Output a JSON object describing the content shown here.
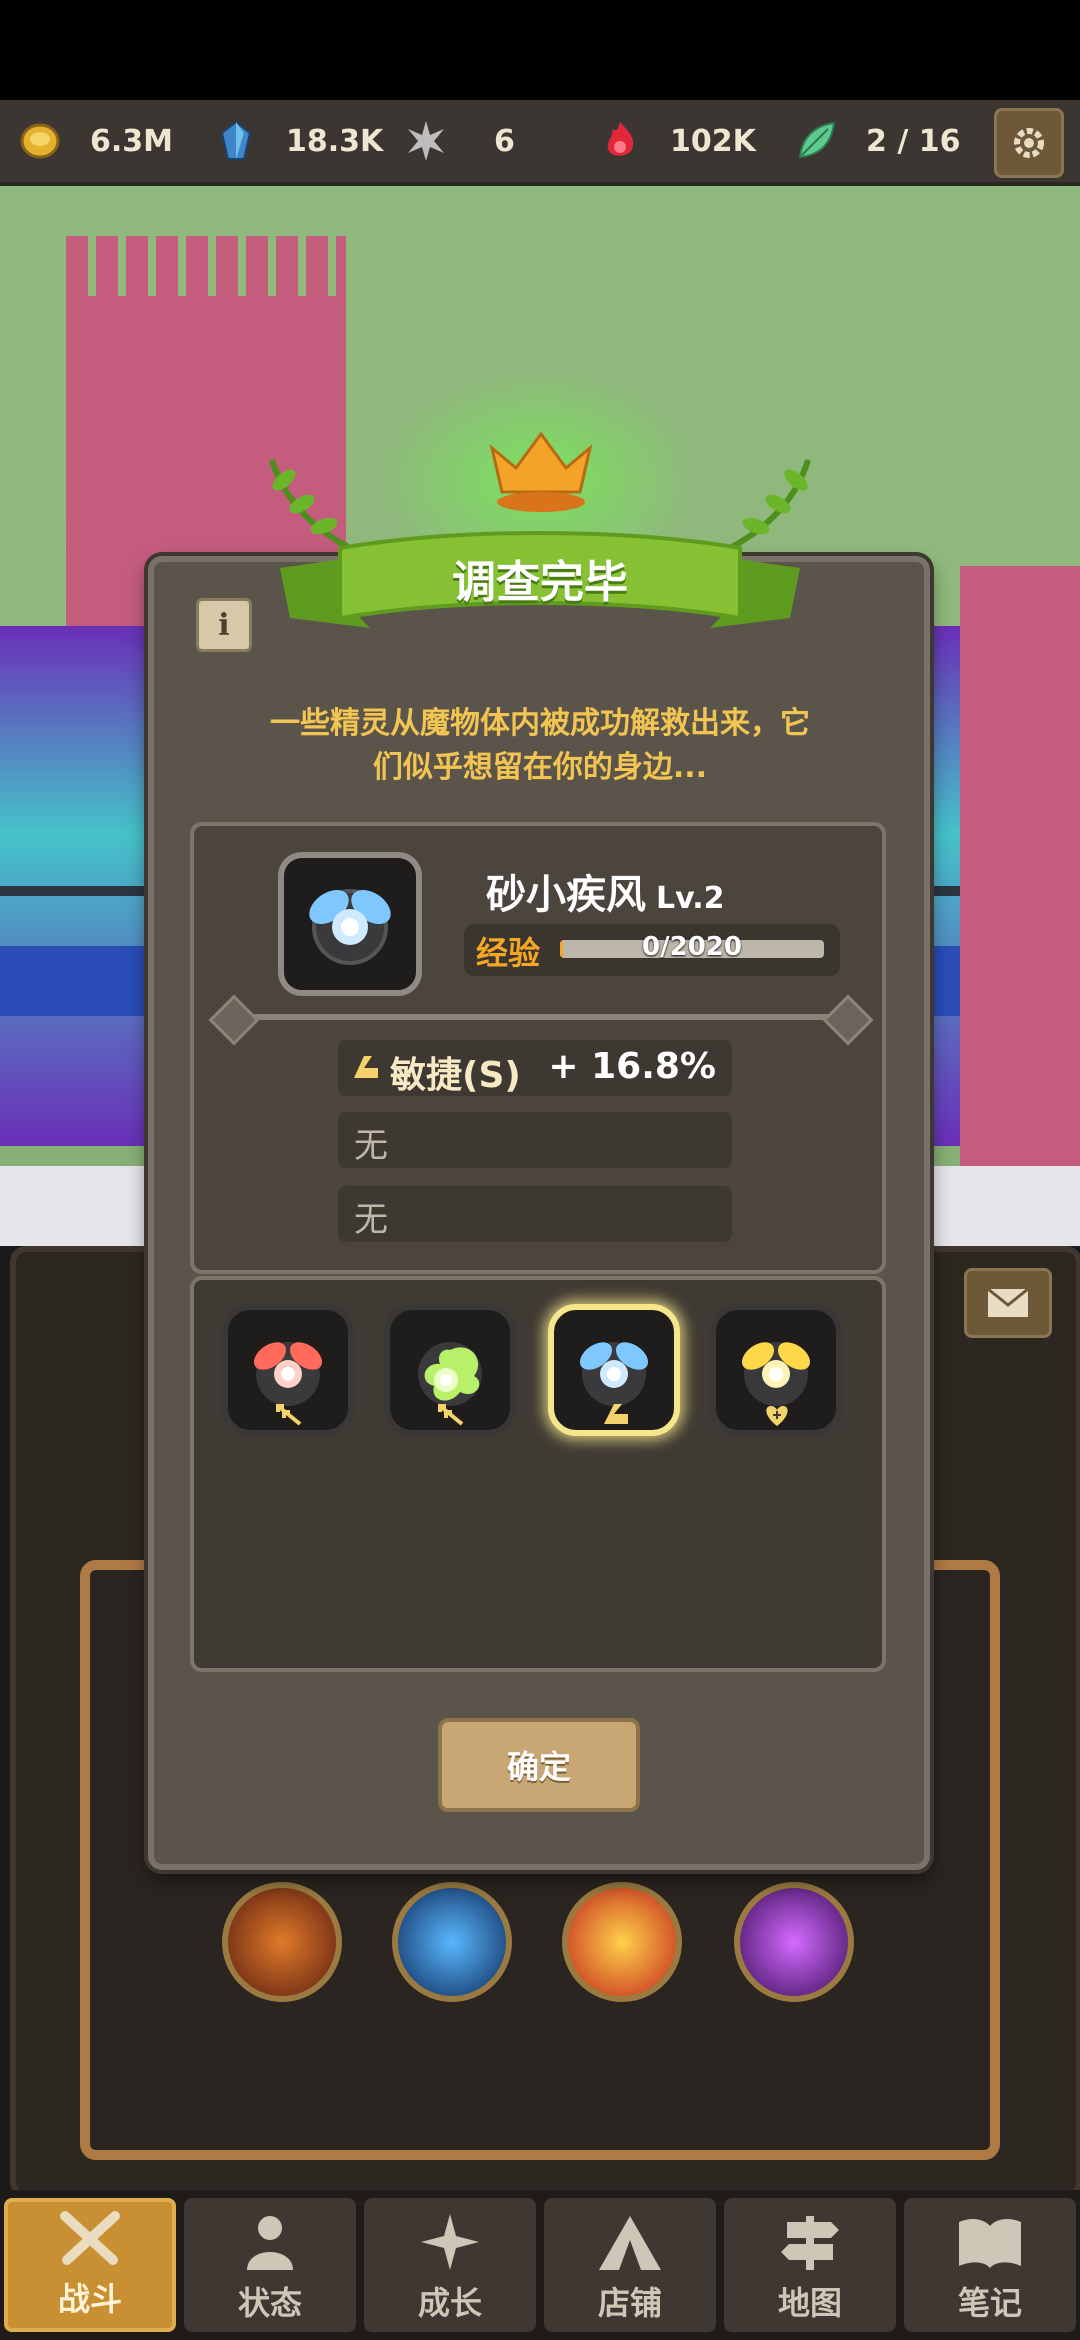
{
  "resources": [
    {
      "icon": "gold-coin-icon",
      "value": "6.3M"
    },
    {
      "icon": "blue-crystal-icon",
      "value": "18.3K"
    },
    {
      "icon": "star-shard-icon",
      "value": "6"
    },
    {
      "icon": "red-flame-gem-icon",
      "value": "102K"
    },
    {
      "icon": "green-leaf-icon",
      "value": "2 / 16"
    }
  ],
  "dialog": {
    "title": "调查完毕",
    "description_line1": "一些精灵从魔物体内被成功解救出来，它",
    "description_line2": "们似乎想留在你的身边...",
    "spirit": {
      "name": "砂小疾风",
      "level": "Lv.2",
      "exp_label": "经验",
      "exp_text": "0/2020",
      "exp_fraction": 0.0
    },
    "stats": [
      {
        "name": "敏捷(S)",
        "value": "+ 16.8%"
      },
      {
        "name": "无",
        "value": ""
      },
      {
        "name": "无",
        "value": ""
      }
    ],
    "spirit_slots": [
      {
        "color": "#ff6a5a",
        "badge": "arrow-up-icon"
      },
      {
        "color": "#b9f06a",
        "badge": "arrow-up-icon"
      },
      {
        "color": "#7ec8ff",
        "badge": "boot-icon",
        "selected": true
      },
      {
        "color": "#ffd84a",
        "badge": "heart-plus-icon"
      }
    ],
    "confirm_label": "确定"
  },
  "nav": [
    {
      "label": "战斗",
      "icon": "crossed-swords-icon",
      "active": true
    },
    {
      "label": "状态",
      "icon": "person-icon"
    },
    {
      "label": "成长",
      "icon": "sparkle-icon"
    },
    {
      "label": "店铺",
      "icon": "tent-icon"
    },
    {
      "label": "地图",
      "icon": "signpost-icon"
    },
    {
      "label": "笔记",
      "icon": "book-icon"
    }
  ],
  "colors": {
    "accent_gold": "#f5a623",
    "ribbon_green": "#7cb82f",
    "panel_brown": "#5b544b"
  }
}
